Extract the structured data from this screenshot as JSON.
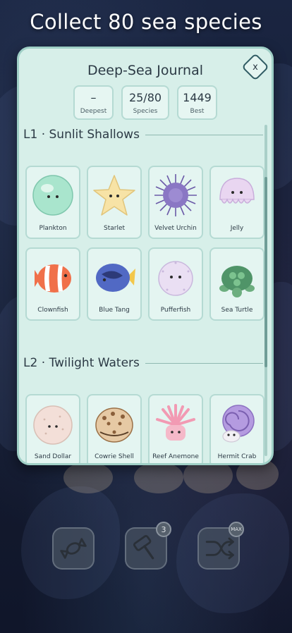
{
  "headline": "Collect 80 sea species",
  "journal": {
    "title": "Deep-Sea Journal",
    "close_label": "x",
    "stats": [
      {
        "value": "–",
        "label": "Deepest"
      },
      {
        "value": "25/80",
        "label": "Species"
      },
      {
        "value": "1449",
        "label": "Best"
      }
    ],
    "levels": [
      {
        "title": "L1 · Sunlit Shallows",
        "species": [
          {
            "name": "Plankton",
            "icon": "plankton-icon"
          },
          {
            "name": "Starlet",
            "icon": "starlet-icon"
          },
          {
            "name": "Velvet Urchin",
            "icon": "urchin-icon"
          },
          {
            "name": "Jelly",
            "icon": "jelly-icon"
          },
          {
            "name": "Clownfish",
            "icon": "clownfish-icon"
          },
          {
            "name": "Blue Tang",
            "icon": "blue-tang-icon"
          },
          {
            "name": "Pufferfish",
            "icon": "pufferfish-icon"
          },
          {
            "name": "Sea Turtle",
            "icon": "sea-turtle-icon"
          }
        ]
      },
      {
        "title": "L2 · Twilight Waters",
        "species": [
          {
            "name": "Sand Dollar",
            "icon": "sand-dollar-icon"
          },
          {
            "name": "Cowrie Shell",
            "icon": "cowrie-icon"
          },
          {
            "name": "Reef Anemone",
            "icon": "anemone-icon"
          },
          {
            "name": "Hermit Crab",
            "icon": "hermit-crab-icon"
          }
        ]
      }
    ]
  },
  "toolbar": {
    "hammer_count": "3",
    "shuffle_badge": "MAX"
  }
}
